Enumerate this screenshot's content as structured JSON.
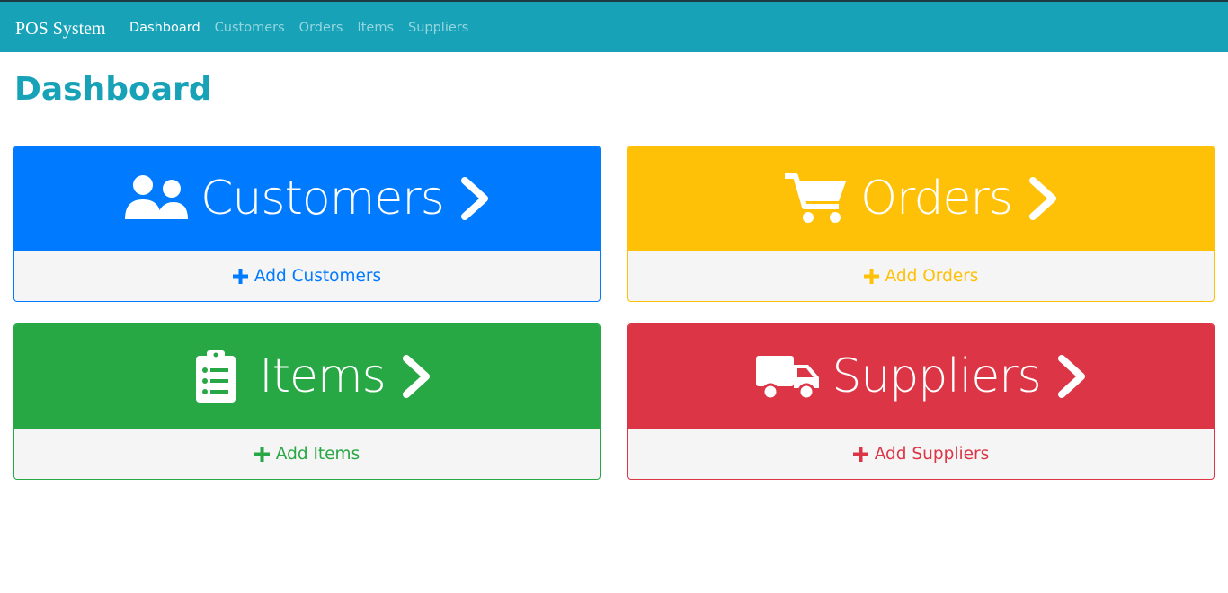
{
  "navbar": {
    "brand": "POS System",
    "links": [
      {
        "label": "Dashboard",
        "active": true
      },
      {
        "label": "Customers",
        "active": false
      },
      {
        "label": "Orders",
        "active": false
      },
      {
        "label": "Items",
        "active": false
      },
      {
        "label": "Suppliers",
        "active": false
      }
    ],
    "color": "#17a2b8"
  },
  "page": {
    "title": "Dashboard"
  },
  "cards": {
    "customers": {
      "label": "Customers",
      "icon": "users-icon",
      "action": "Add Customers",
      "color": "#007bff"
    },
    "orders": {
      "label": "Orders",
      "icon": "shopping-cart-icon",
      "action": "Add Orders",
      "color": "#ffc107"
    },
    "items": {
      "label": "Items",
      "icon": "clipboard-list-icon",
      "action": "Add Items",
      "color": "#28a745"
    },
    "suppliers": {
      "label": "Suppliers",
      "icon": "truck-icon",
      "action": "Add Suppliers",
      "color": "#dc3545"
    }
  }
}
